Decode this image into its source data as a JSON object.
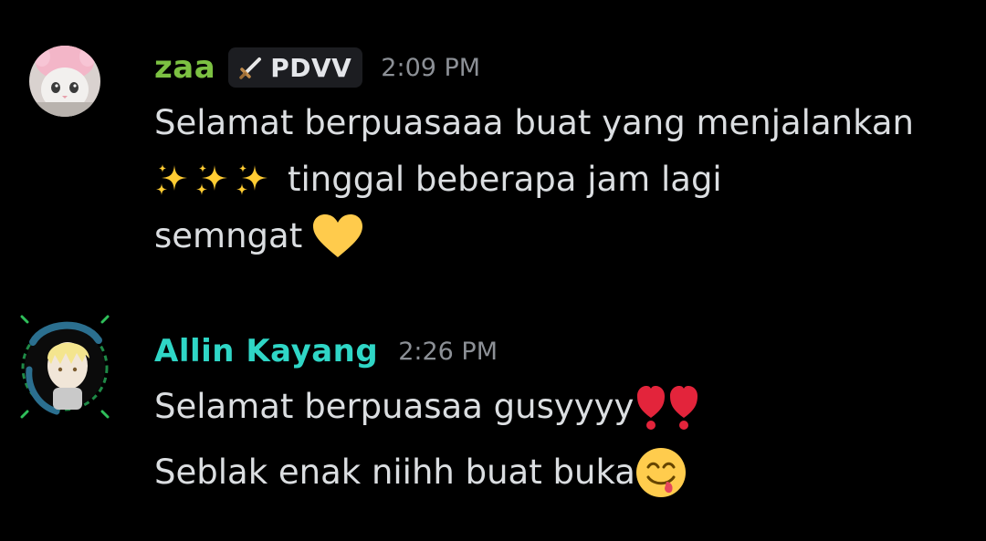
{
  "messages": [
    {
      "username": "zaa",
      "username_color": "#7cc142",
      "tag": {
        "icon": "sword-icon",
        "label": "PDVV"
      },
      "timestamp": "2:09 PM",
      "lines": {
        "line1": "Selamat berpuasaaa buat yang menjalankan",
        "line2_text": "tinggal beberapa jam lagi",
        "line3_text": "semngat"
      },
      "emojis": [
        "sparkles-icon",
        "sparkles-icon",
        "sparkles-icon",
        "yellow-heart-icon"
      ]
    },
    {
      "username": "Allin Kayang",
      "username_color": "#2fd6c6",
      "timestamp": "2:26 PM",
      "lines": {
        "line1_text": "Selamat berpuasaa gusyyyy",
        "line2_text": "Seblak enak niihh buat buka"
      },
      "emojis": [
        "red-exclamation-icon",
        "red-exclamation-icon",
        "yum-face-icon"
      ]
    }
  ]
}
